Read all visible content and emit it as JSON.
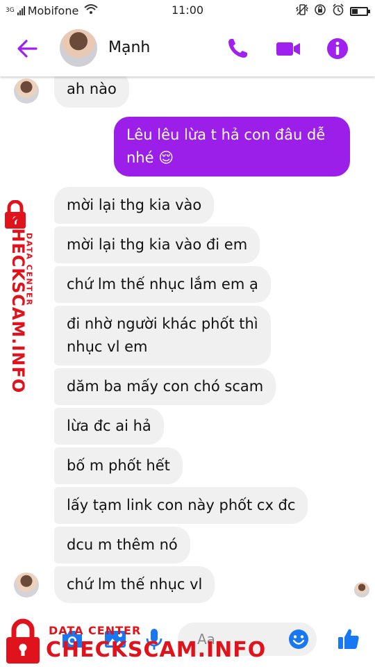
{
  "status_bar": {
    "network_label": "3G",
    "carrier": "Mobifone",
    "time": "11:00"
  },
  "header": {
    "contact_name": "Mạnh"
  },
  "messages": [
    {
      "sender": "contact",
      "text": "ah nào"
    },
    {
      "sender": "me",
      "text": "Lêu lêu lừa t hả con đâu dễ\nnhé 😌"
    },
    {
      "sender": "contact",
      "text": "mời lại thg kia vào"
    },
    {
      "sender": "contact",
      "text": "mời lại thg kia vào đi em"
    },
    {
      "sender": "contact",
      "text": "chứ lm thế nhục lắm em ạ"
    },
    {
      "sender": "contact",
      "text": "đi nhờ người khác phốt thì\nnhục vl em"
    },
    {
      "sender": "contact",
      "text": "dăm ba mấy con chó scam"
    },
    {
      "sender": "contact",
      "text": "lừa đc ai hả"
    },
    {
      "sender": "contact",
      "text": "bố m phốt hết"
    },
    {
      "sender": "contact",
      "text": "lấy tạm link con này phốt cx đc"
    },
    {
      "sender": "contact",
      "text": "dcu m thêm nó"
    },
    {
      "sender": "contact",
      "text": "chứ lm thế nhục vl"
    }
  ],
  "composer": {
    "placeholder": "Aa"
  },
  "watermark": {
    "brand": "CHECKSCAM.INFO",
    "subtitle": "DATA CENTER"
  },
  "colors": {
    "accent": "#a020f0",
    "outgoing_bubble": "#9b1fe8",
    "incoming_bubble": "#f1f0f0",
    "like_blue": "#1877f2",
    "watermark_red": "#e0121b"
  },
  "icons": [
    "back-arrow-icon",
    "phone-icon",
    "video-camera-icon",
    "info-icon",
    "camera-icon",
    "image-icon",
    "microphone-icon",
    "emoji-icon",
    "thumbs-up-icon",
    "lock-icon"
  ]
}
